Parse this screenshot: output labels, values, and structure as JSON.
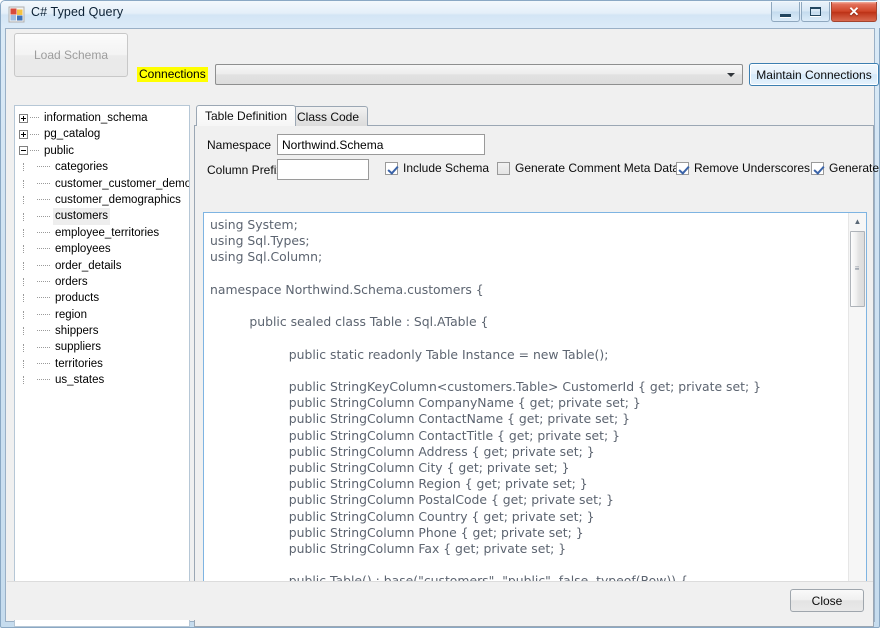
{
  "window": {
    "title": "C# Typed Query",
    "icon": "app-icon",
    "caption": {
      "minimize": "minimize-icon",
      "maximize": "maximize-icon",
      "close": "✕"
    }
  },
  "toolbar": {
    "load_schema_label": "Load Schema",
    "connections_label": "Connections",
    "connections_combo_value": "",
    "maintain_connections_label": "Maintain Connections",
    "dropdown_icon": "chevron-down-icon"
  },
  "tree": {
    "items": [
      {
        "label": "information_schema",
        "level": 0,
        "expander": "plus"
      },
      {
        "label": "pg_catalog",
        "level": 0,
        "expander": "plus"
      },
      {
        "label": "public",
        "level": 0,
        "expander": "minus"
      },
      {
        "label": "categories",
        "level": 1,
        "expander": "none",
        "selected": false
      },
      {
        "label": "customer_customer_demo",
        "level": 1,
        "expander": "none",
        "selected": false
      },
      {
        "label": "customer_demographics",
        "level": 1,
        "expander": "none",
        "selected": false
      },
      {
        "label": "customers",
        "level": 1,
        "expander": "none",
        "selected": true
      },
      {
        "label": "employee_territories",
        "level": 1,
        "expander": "none",
        "selected": false
      },
      {
        "label": "employees",
        "level": 1,
        "expander": "none",
        "selected": false
      },
      {
        "label": "order_details",
        "level": 1,
        "expander": "none",
        "selected": false
      },
      {
        "label": "orders",
        "level": 1,
        "expander": "none",
        "selected": false
      },
      {
        "label": "products",
        "level": 1,
        "expander": "none",
        "selected": false
      },
      {
        "label": "region",
        "level": 1,
        "expander": "none",
        "selected": false
      },
      {
        "label": "shippers",
        "level": 1,
        "expander": "none",
        "selected": false
      },
      {
        "label": "suppliers",
        "level": 1,
        "expander": "none",
        "selected": false
      },
      {
        "label": "territories",
        "level": 1,
        "expander": "none",
        "selected": false
      },
      {
        "label": "us_states",
        "level": 1,
        "expander": "none",
        "selected": false
      }
    ]
  },
  "tabs": [
    {
      "label": "Table Definition",
      "active": true
    },
    {
      "label": "Class Code",
      "active": false
    }
  ],
  "form": {
    "namespace_label": "Namespace",
    "namespace_value": "Northwind.Schema",
    "column_prefix_label": "Column Prefix",
    "column_prefix_value": "",
    "column_prefix_placeholder": "",
    "checkboxes": [
      {
        "label": "Include Schema",
        "checked": true
      },
      {
        "label": "Generate Comment Meta Data",
        "checked": false
      },
      {
        "label": "Remove Underscores",
        "checked": true
      },
      {
        "label": "Generate",
        "checked": true
      }
    ]
  },
  "code": {
    "text": "using System;\nusing Sql.Types;\nusing Sql.Column;\n\nnamespace Northwind.Schema.customers {\n\n          public sealed class Table : Sql.ATable {\n\n                    public static readonly Table Instance = new Table();\n\n                    public StringKeyColumn<customers.Table> CustomerId { get; private set; }\n                    public StringColumn CompanyName { get; private set; }\n                    public StringColumn ContactName { get; private set; }\n                    public StringColumn ContactTitle { get; private set; }\n                    public StringColumn Address { get; private set; }\n                    public StringColumn City { get; private set; }\n                    public StringColumn Region { get; private set; }\n                    public StringColumn PostalCode { get; private set; }\n                    public StringColumn Country { get; private set; }\n                    public StringColumn Phone { get; private set; }\n                    public StringColumn Fax { get; private set; }\n\n                    public Table() : base(\"customers\", \"public\", false, typeof(Row)) {\n\n                              CustomerId = new StringKeyColumn<customers.Table>(this, \"custor"
  },
  "scrollbars": {
    "vertical_up_icon": "▲",
    "vertical_down_icon": "▼",
    "horizontal_left_icon": "◀",
    "horizontal_right_icon": "▶",
    "grip_icon": "≡"
  },
  "footer": {
    "close_label": "Close"
  }
}
